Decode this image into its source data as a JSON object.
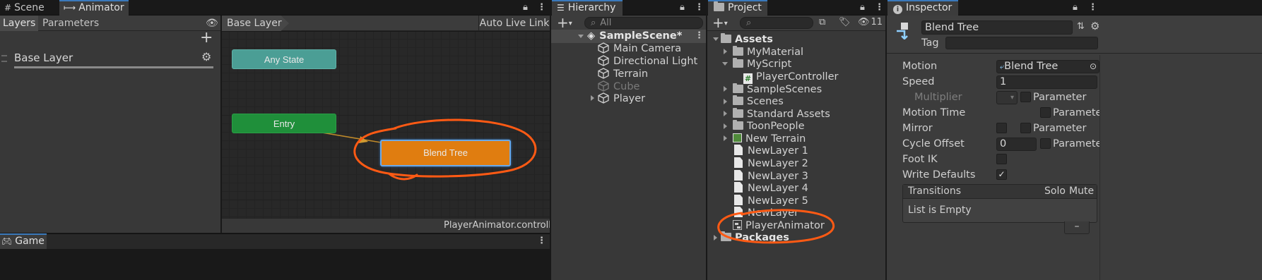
{
  "animator": {
    "tabs": {
      "scene": "Scene",
      "animator": "Animator"
    },
    "left_tabs": {
      "layers": "Layers",
      "parameters": "Parameters"
    },
    "layer_name": "Base Layer",
    "breadcrumb": "Base Layer",
    "auto_live_link": "Auto Live Link",
    "states": {
      "any_state": "Any State",
      "entry": "Entry",
      "blend_tree": "Blend Tree"
    },
    "footer": "PlayerAnimator.controller"
  },
  "game_tab": "Game",
  "hierarchy": {
    "tab": "Hierarchy",
    "search_placeholder": "All",
    "scene": "SampleScene*",
    "items": [
      "Main Camera",
      "Directional Light",
      "Terrain",
      "Cube",
      "Player"
    ]
  },
  "project": {
    "tab": "Project",
    "hidden_count": "11",
    "root": "Assets",
    "items": [
      "MyMaterial",
      "MyScript",
      "PlayerController",
      "SampleScenes",
      "Scenes",
      "Standard Assets",
      "ToonPeople",
      "New Terrain",
      "NewLayer 1",
      "NewLayer 2",
      "NewLayer 3",
      "NewLayer 4",
      "NewLayer 5",
      "NewLayer",
      "PlayerAnimator",
      "Packages"
    ]
  },
  "inspector": {
    "tab": "Inspector",
    "name": "Blend Tree",
    "tag_label": "Tag",
    "motion_label": "Motion",
    "motion_value": "Blend Tree",
    "speed_label": "Speed",
    "speed_value": "1",
    "multiplier_label": "Multiplier",
    "motion_time_label": "Motion Time",
    "mirror_label": "Mirror",
    "cycle_offset_label": "Cycle Offset",
    "cycle_offset_value": "0",
    "foot_ik_label": "Foot IK",
    "write_defaults_label": "Write Defaults",
    "parameter_label": "Parameter",
    "transitions_label": "Transitions",
    "solo_label": "Solo",
    "mute_label": "Mute",
    "list_empty": "List is Empty",
    "remove_symbol": "–"
  },
  "colors": {
    "accent": "#3a79bb",
    "annotation": "#ff5a14",
    "blend_tree": "#e07d10",
    "entry": "#1f8f3a",
    "any_state": "#4b9e95"
  }
}
